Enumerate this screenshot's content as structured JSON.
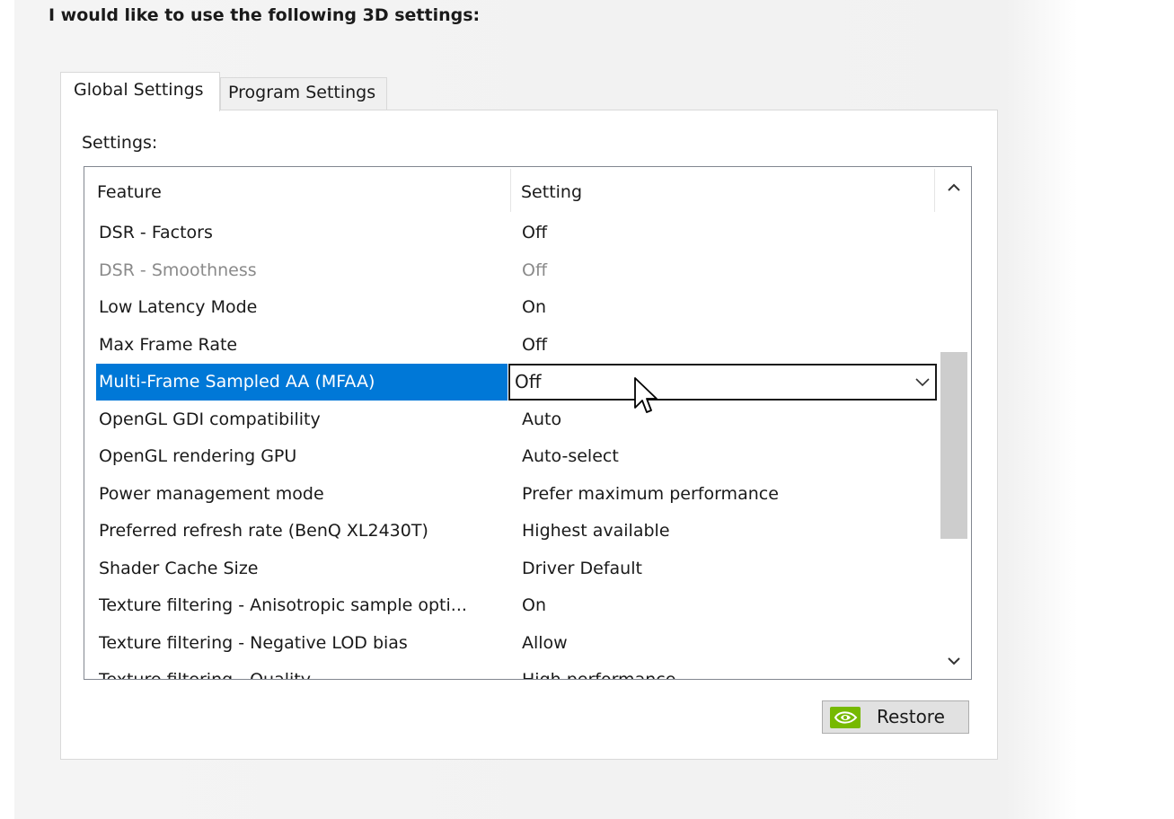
{
  "heading": "I would like to use the following 3D settings:",
  "tabs": [
    {
      "label": "Global Settings",
      "active": true
    },
    {
      "label": "Program Settings",
      "active": false
    }
  ],
  "settings_label": "Settings:",
  "table": {
    "columns": [
      "Feature",
      "Setting"
    ],
    "rows": [
      {
        "feature": "DSR - Factors",
        "setting": "Off"
      },
      {
        "feature": "DSR - Smoothness",
        "setting": "Off",
        "disabled": true
      },
      {
        "feature": "Low Latency Mode",
        "setting": "On"
      },
      {
        "feature": "Max Frame Rate",
        "setting": "Off"
      },
      {
        "feature": "Multi-Frame Sampled AA (MFAA)",
        "setting": "Off",
        "selected": true
      },
      {
        "feature": "OpenGL GDI compatibility",
        "setting": "Auto"
      },
      {
        "feature": "OpenGL rendering GPU",
        "setting": "Auto-select"
      },
      {
        "feature": "Power management mode",
        "setting": "Prefer maximum performance"
      },
      {
        "feature": "Preferred refresh rate (BenQ XL2430T)",
        "setting": "Highest available"
      },
      {
        "feature": "Shader Cache Size",
        "setting": "Driver Default"
      },
      {
        "feature": "Texture filtering - Anisotropic sample opti...",
        "setting": "On"
      },
      {
        "feature": "Texture filtering - Negative LOD bias",
        "setting": "Allow"
      },
      {
        "feature": "Texture filtering - Quality",
        "setting": "High performance"
      }
    ]
  },
  "restore_button": {
    "label": "Restore",
    "icon": "nvidia-logo-icon"
  },
  "colors": {
    "selection": "#0078d7",
    "nvidia_green": "#76b900",
    "disabled_text": "#8a8a8a"
  },
  "icons": {
    "dropdown": "chevron-down-icon",
    "scroll_up": "chevron-up-icon",
    "scroll_down": "chevron-down-icon",
    "cursor": "mouse-pointer-icon"
  }
}
